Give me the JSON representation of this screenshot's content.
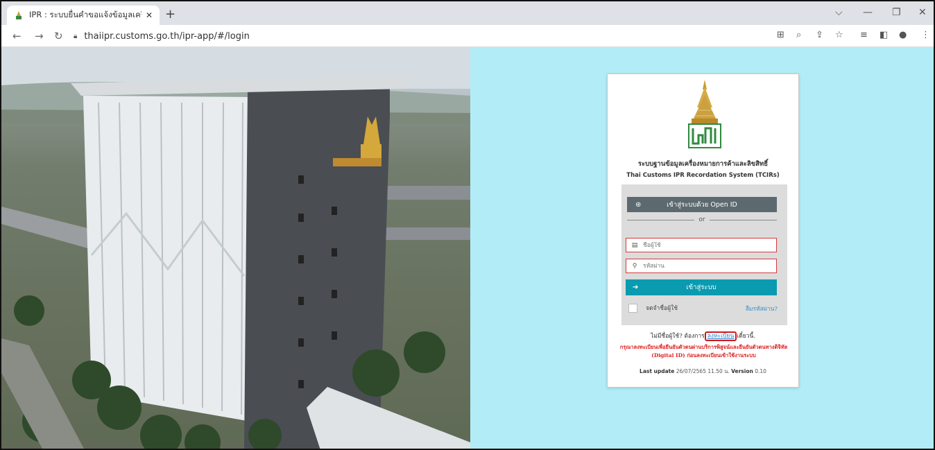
{
  "browser": {
    "tab_title": "IPR : ระบบยื่นคำขอแจ้งข้อมูลเครื่องหม",
    "tab_close": "✕",
    "new_tab": "+",
    "url": "thaiipr.customs.go.th/ipr-app/#/login",
    "icons": [
      "back-arrow-icon",
      "forward-arrow-icon",
      "reload-icon",
      "lock-icon",
      "translate-icon",
      "zoom-icon",
      "share-icon",
      "star-icon",
      "reading-list-icon",
      "side-panel-icon",
      "profile-icon",
      "menu-kebab-icon",
      "minimize-icon",
      "maximize-icon",
      "close-icon",
      "chevron-down-icon"
    ]
  },
  "login": {
    "system_name_th": "ระบบฐานข้อมูลเครื่องหมายการค้าและลิขสิทธิ์",
    "system_name_en": "Thai Customs IPR Recordation System (TCIRs)",
    "openid_label": "เข้าสู่ระบบด้วย Open ID",
    "or_label": "or",
    "username_placeholder": "ชื่อผู้ใช้",
    "password_placeholder": "รหัสผ่าน",
    "login_label": "เข้าสู่ระบบ",
    "remember_label": "จดจำชื่อผู้ใช้",
    "forgot_label": "ลืมรหัสผ่าน?",
    "register_prefix": "ไม่มีชื่อผู้ใช้? ต้องการ",
    "register_link": "ลงทะเบียน",
    "register_suffix": "เดี๋ยวนี้.",
    "notice": "กรุณาลงทะเบียนเพื่อยืนยันตัวตนผ่านบริการพิสูจน์และยืนยันตัวตนทางดิจิทัล (Digital ID) ก่อนลงทะเบียนเข้าใช้งานระบบ",
    "last_update_label": "Last update",
    "last_update_value": "26/07/2565 11.50 น.",
    "version_label": "Version",
    "version_value": "0.10"
  },
  "colors": {
    "right_background": "#b2edf7",
    "openid_button": "#5c6a70",
    "login_button": "#0a9bb0",
    "field_border": "#d23a3a",
    "notice_text": "#e02020"
  }
}
